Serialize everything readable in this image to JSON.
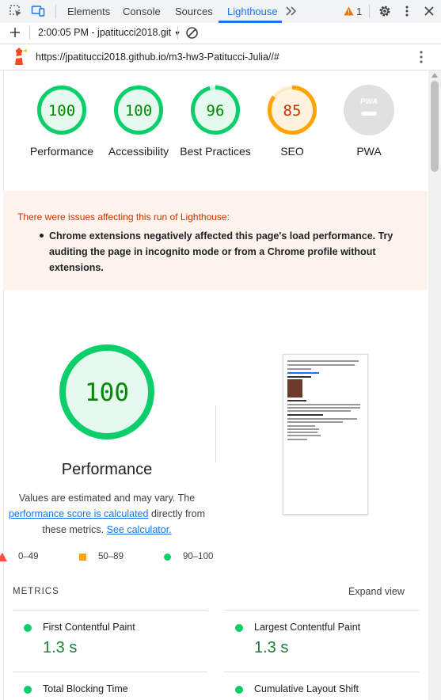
{
  "devtools": {
    "tabs": [
      {
        "label": "Elements"
      },
      {
        "label": "Console"
      },
      {
        "label": "Sources"
      },
      {
        "label": "Lighthouse"
      }
    ],
    "issues_count": "1"
  },
  "toolbar": {
    "report_selector": "2:00:05 PM - jpatitucci2018.git"
  },
  "report": {
    "url": "https://jpatitucci2018.github.io/m3-hw3-Patitucci-Julia//#"
  },
  "scores": [
    {
      "label": "Performance",
      "value": "100",
      "score": 100
    },
    {
      "label": "Accessibility",
      "value": "100",
      "score": 100
    },
    {
      "label": "Best Practices",
      "value": "96",
      "score": 96
    },
    {
      "label": "SEO",
      "value": "85",
      "score": 85
    },
    {
      "label": "PWA",
      "value": ""
    }
  ],
  "warning": {
    "title": "There were issues affecting this run of Lighthouse:",
    "item": "Chrome extensions negatively affected this page's load performance. Try auditing the page in incognito mode or from a Chrome profile without extensions."
  },
  "performance": {
    "score": "100",
    "label": "Performance",
    "desc_1": "Values are estimated and may vary. The",
    "desc_link": "performance score is calculated",
    "desc_2": "directly from these metrics.",
    "calc_link": "See calculator.",
    "legend": [
      {
        "range": "0–49",
        "color": "#ff4e42"
      },
      {
        "range": "50–89",
        "color": "#ffa400"
      },
      {
        "range": "90–100",
        "color": "#0cce6b"
      }
    ]
  },
  "metrics": {
    "header": "METRICS",
    "expand": "Expand view",
    "items": [
      {
        "title": "First Contentful Paint",
        "value": "1.3 s"
      },
      {
        "title": "Largest Contentful Paint",
        "value": "1.3 s"
      },
      {
        "title": "Total Blocking Time",
        "value": ""
      },
      {
        "title": "Cumulative Layout Shift",
        "value": ""
      }
    ]
  },
  "colors": {
    "pass": "#0cce6b",
    "pass_text": "#008800",
    "average": "#ffa400",
    "average_text": "#c33300",
    "fail": "#ff4e42",
    "accent": "#1a73e8"
  }
}
